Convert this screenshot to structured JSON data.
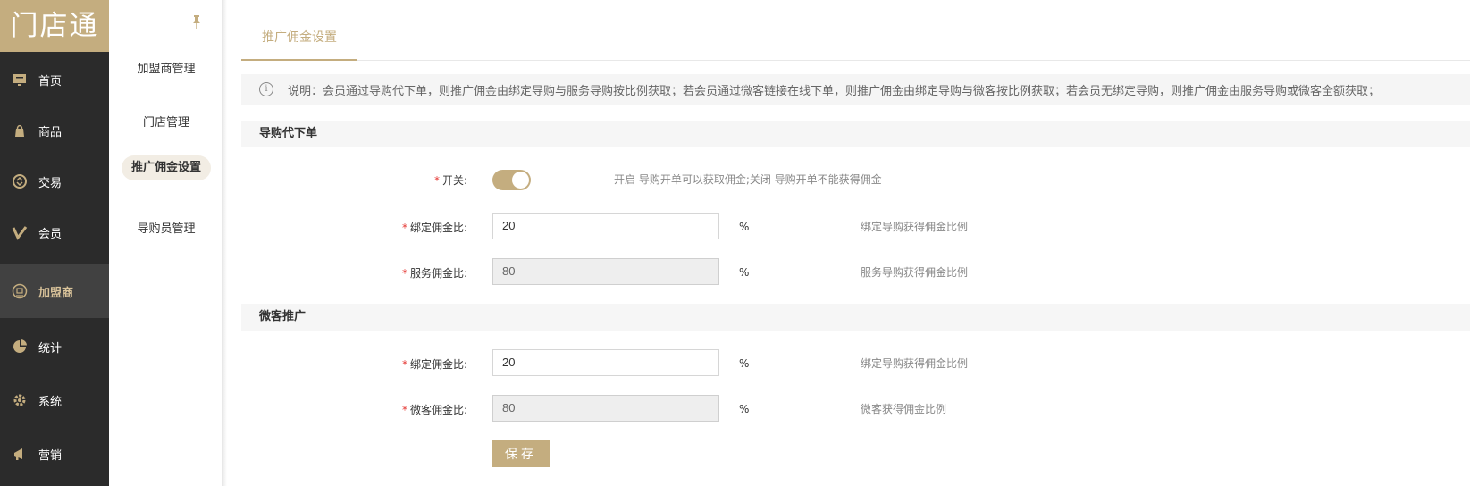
{
  "app": {
    "logo_text": "门店通",
    "accent_color": "#c4ad7f",
    "nav_bg": "#2b2b2b"
  },
  "nav": {
    "items": [
      {
        "label": "首页",
        "icon": "monitor-icon"
      },
      {
        "label": "商品",
        "icon": "bag-icon"
      },
      {
        "label": "交易",
        "icon": "exchange-icon"
      },
      {
        "label": "会员",
        "icon": "v-icon"
      },
      {
        "label": "加盟商",
        "icon": "franchise-icon",
        "active": true
      },
      {
        "label": "统计",
        "icon": "pie-icon"
      },
      {
        "label": "系统",
        "icon": "gear-icon"
      },
      {
        "label": "营销",
        "icon": "megaphone-icon"
      }
    ]
  },
  "submenu": {
    "items": [
      {
        "label": "加盟商管理"
      },
      {
        "label": "门店管理"
      },
      {
        "label": "推广佣金设置",
        "active": true
      },
      {
        "label": "导购员管理"
      }
    ]
  },
  "tabs": {
    "active_label": "推广佣金设置"
  },
  "notice": {
    "text": "说明：会员通过导购代下单，则推广佣金由绑定导购与服务导购按比例获取；若会员通过微客链接在线下单，则推广佣金由绑定导购与微客按比例获取；若会员无绑定导购，则推广佣金由服务导购或微客全额获取；"
  },
  "section1": {
    "title": "导购代下单",
    "switch": {
      "label": "开关:",
      "state": "on",
      "hint": "开启 导购开单可以获取佣金;关闭 导购开单不能获得佣金"
    },
    "bind_ratio": {
      "label": "绑定佣金比:",
      "value": "20",
      "unit": "%",
      "hint": "绑定导购获得佣金比例"
    },
    "service_ratio": {
      "label": "服务佣金比:",
      "value": "80",
      "unit": "%",
      "hint": "服务导购获得佣金比例"
    }
  },
  "section2": {
    "title": "微客推广",
    "bind_ratio": {
      "label": "绑定佣金比:",
      "value": "20",
      "unit": "%",
      "hint": "绑定导购获得佣金比例"
    },
    "weike_ratio": {
      "label": "微客佣金比:",
      "value": "80",
      "unit": "%",
      "hint": "微客获得佣金比例"
    }
  },
  "actions": {
    "save_label": "保存"
  }
}
